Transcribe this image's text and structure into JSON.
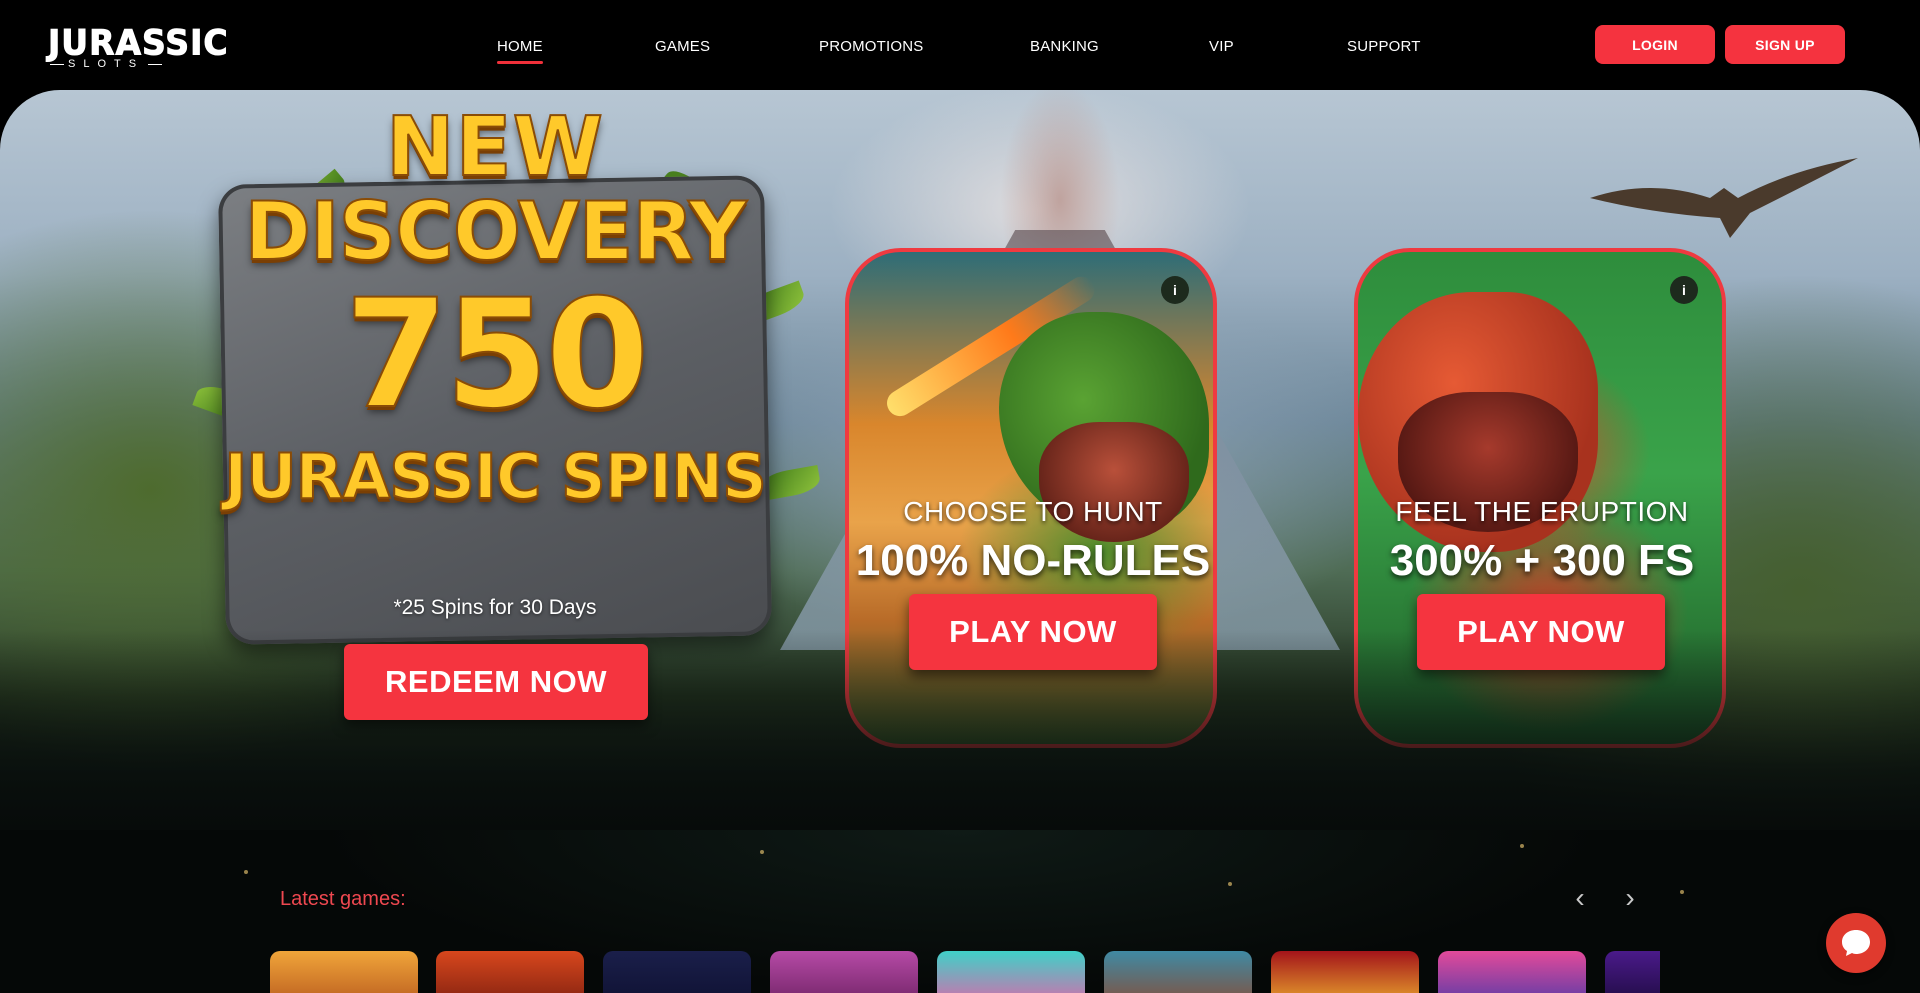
{
  "header": {
    "logo_main": "JURASSIC",
    "logo_sub": "SLOTS",
    "nav": [
      {
        "label": "HOME",
        "active": true
      },
      {
        "label": "GAMES",
        "active": false
      },
      {
        "label": "PROMOTIONS",
        "active": false
      },
      {
        "label": "BANKING",
        "active": false
      },
      {
        "label": "VIP",
        "active": false
      },
      {
        "label": "SUPPORT",
        "active": false
      }
    ],
    "login_label": "LOGIN",
    "signup_label": "SIGN UP"
  },
  "hero": {
    "promo_line1": "NEW",
    "promo_line2": "DISCOVERY",
    "promo_amount": "750",
    "promo_line4": "JURASSIC SPINS",
    "spins_note": "*25 Spins for 30 Days",
    "redeem_label": "REDEEM NOW",
    "cards": [
      {
        "label": " CHOOSE TO HUNT",
        "headline": "100% NO-RULES",
        "cta": "PLAY NOW",
        "info": "i"
      },
      {
        "label": "FEEL THE ERUPTION",
        "headline": "300% + 300 FS",
        "cta": "PLAY NOW",
        "info": "i"
      }
    ]
  },
  "latest": {
    "title": "Latest games:",
    "prev_icon": "chevron-left-icon",
    "next_icon": "chevron-right-icon",
    "prev_glyph": "‹",
    "next_glyph": "›"
  },
  "colors": {
    "accent": "#f5343f",
    "gold": "#ffc92a",
    "background": "#000000"
  },
  "chat_icon": "chat-bubble-icon"
}
